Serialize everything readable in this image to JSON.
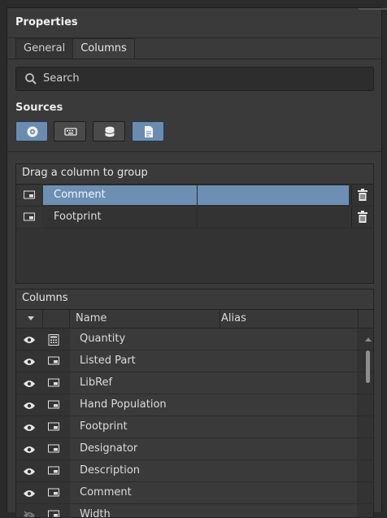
{
  "panel": {
    "title": "Properties"
  },
  "tabs": [
    {
      "label": "General",
      "active": false
    },
    {
      "label": "Columns",
      "active": true
    }
  ],
  "search": {
    "placeholder": "Search"
  },
  "sources": {
    "label": "Sources",
    "buttons": [
      {
        "icon": "component-gear-icon",
        "active": true
      },
      {
        "icon": "keyboard-icon",
        "active": false
      },
      {
        "icon": "database-icon",
        "active": false
      },
      {
        "icon": "document-icon",
        "active": true
      }
    ]
  },
  "group": {
    "header": "Drag a column to group",
    "rows": [
      {
        "name": "Comment",
        "selected": true
      },
      {
        "name": "Footprint",
        "selected": false
      }
    ]
  },
  "columns": {
    "header": "Columns",
    "col_name": "Name",
    "col_alias": "Alias",
    "rows": [
      {
        "name": "Quantity",
        "icon": "calculator-icon",
        "visible": true
      },
      {
        "name": "Listed Part",
        "icon": "parameter-icon",
        "visible": true
      },
      {
        "name": "LibRef",
        "icon": "parameter-icon",
        "visible": true
      },
      {
        "name": "Hand Population",
        "icon": "parameter-icon",
        "visible": true
      },
      {
        "name": "Footprint",
        "icon": "parameter-icon",
        "visible": true
      },
      {
        "name": "Designator",
        "icon": "parameter-icon",
        "visible": true
      },
      {
        "name": "Description",
        "icon": "parameter-icon",
        "visible": true
      },
      {
        "name": "Comment",
        "icon": "parameter-icon",
        "visible": true
      },
      {
        "name": "Width",
        "icon": "parameter-icon",
        "visible": false
      }
    ]
  },
  "colors": {
    "accent": "#6e8fb4",
    "panel_bg": "#3a3a3a",
    "text": "#dcdcdc"
  }
}
